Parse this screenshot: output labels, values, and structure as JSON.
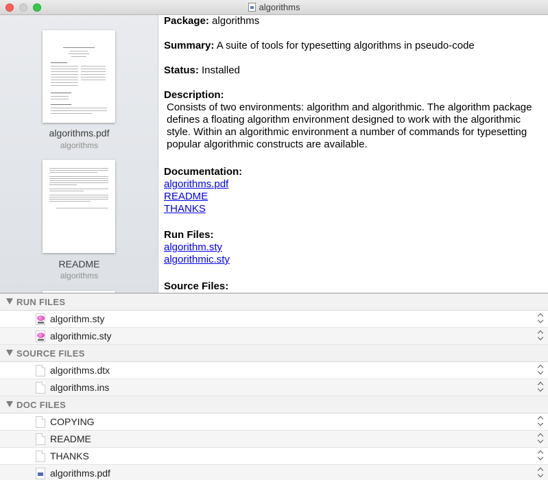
{
  "window": {
    "title": "algorithms"
  },
  "sidebar": {
    "thumbnails": [
      {
        "label": "algorithms.pdf",
        "sublabel": "algorithms"
      },
      {
        "label": "README",
        "sublabel": "algorithms"
      }
    ]
  },
  "info": {
    "package_label": "Package:",
    "package_value": "algorithms",
    "summary_label": "Summary:",
    "summary_value": "A suite of tools for typesetting algorithms in pseudo-code",
    "status_label": "Status:",
    "status_value": "Installed",
    "description_label": "Description:",
    "description_text": "Consists of two environments: algorithm and algorithmic. The algorithm package defines a floating algorithm environment designed to work with the algorithmic style. Within an algorithmic environment a number of commands for typesetting popular algorithmic constructs are available.",
    "documentation_label": "Documentation:",
    "documentation_links": [
      "algorithms.pdf",
      "README",
      "THANKS"
    ],
    "runfiles_label": "Run Files:",
    "runfiles_links": [
      "algorithm.sty",
      "algorithmic.sty"
    ],
    "sourcefiles_label": "Source Files:"
  },
  "filelist": {
    "sections": [
      {
        "title": "RUN FILES",
        "files": [
          {
            "name": "algorithm.sty",
            "icon": "tex-file-icon"
          },
          {
            "name": "algorithmic.sty",
            "icon": "tex-file-icon"
          }
        ]
      },
      {
        "title": "SOURCE FILES",
        "files": [
          {
            "name": "algorithms.dtx",
            "icon": "document-icon"
          },
          {
            "name": "algorithms.ins",
            "icon": "document-icon"
          }
        ]
      },
      {
        "title": "DOC FILES",
        "files": [
          {
            "name": "COPYING",
            "icon": "document-icon"
          },
          {
            "name": "README",
            "icon": "document-icon"
          },
          {
            "name": "THANKS",
            "icon": "document-icon"
          },
          {
            "name": "algorithms.pdf",
            "icon": "pdf-file-icon"
          }
        ]
      }
    ]
  },
  "colors": {
    "link": "#0000ee",
    "close": "#fc605b",
    "zoom": "#34c84a"
  }
}
